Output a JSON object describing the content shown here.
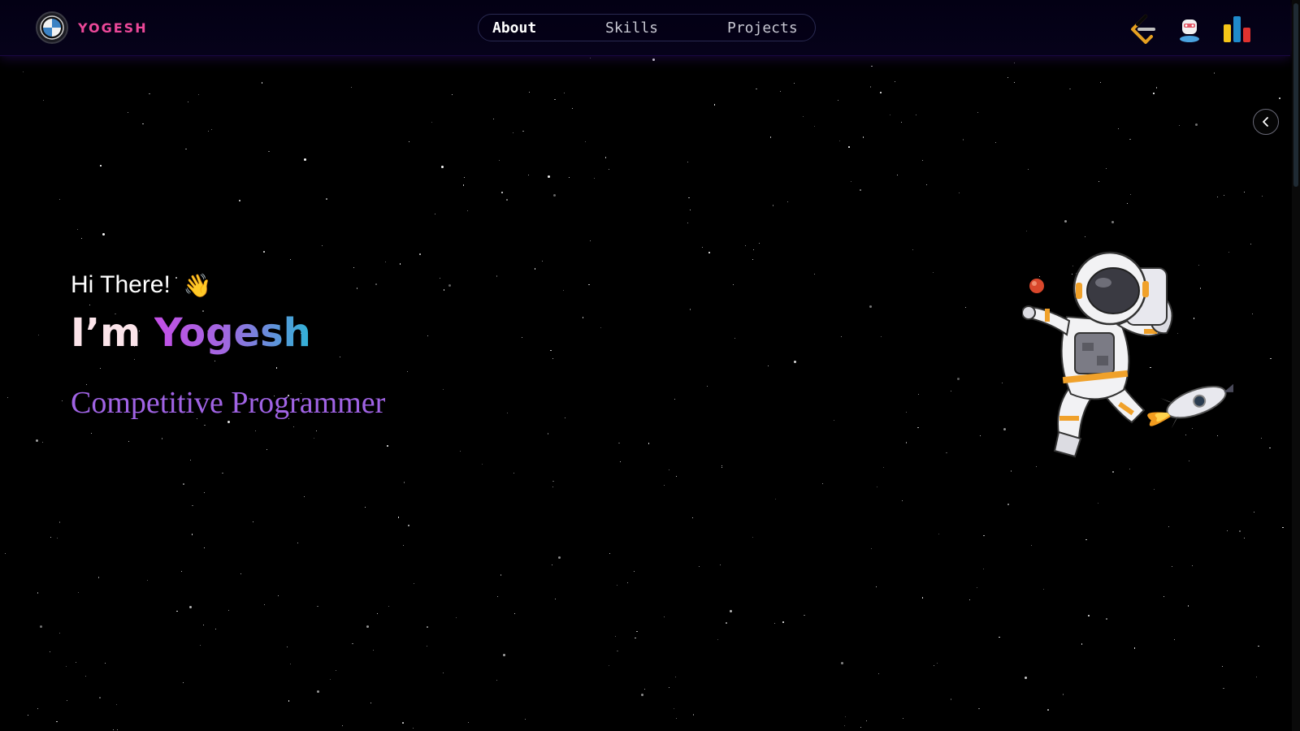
{
  "brand": {
    "name": "YOGESH",
    "logo_icon": "bmw-logo-icon"
  },
  "nav": {
    "links": [
      {
        "label": "About",
        "active": true
      },
      {
        "label": "Skills",
        "active": false
      },
      {
        "label": "Projects",
        "active": false
      }
    ]
  },
  "socials": [
    {
      "icon": "leetcode-icon"
    },
    {
      "icon": "geeksforgeeks-icon"
    },
    {
      "icon": "codeforces-icon"
    }
  ],
  "side_toggle": {
    "icon": "chevron-left-icon"
  },
  "hero": {
    "greeting": "Hi There!",
    "wave_emoji": "👋",
    "im": "I’m",
    "name": "Yogesh",
    "role": "Competitive Programmer"
  },
  "colors": {
    "background": "#000000",
    "brand": "#ec4899",
    "name_gradient_start": "#c44fe6",
    "name_gradient_end": "#2fb3d6",
    "role": "#a063e4"
  }
}
